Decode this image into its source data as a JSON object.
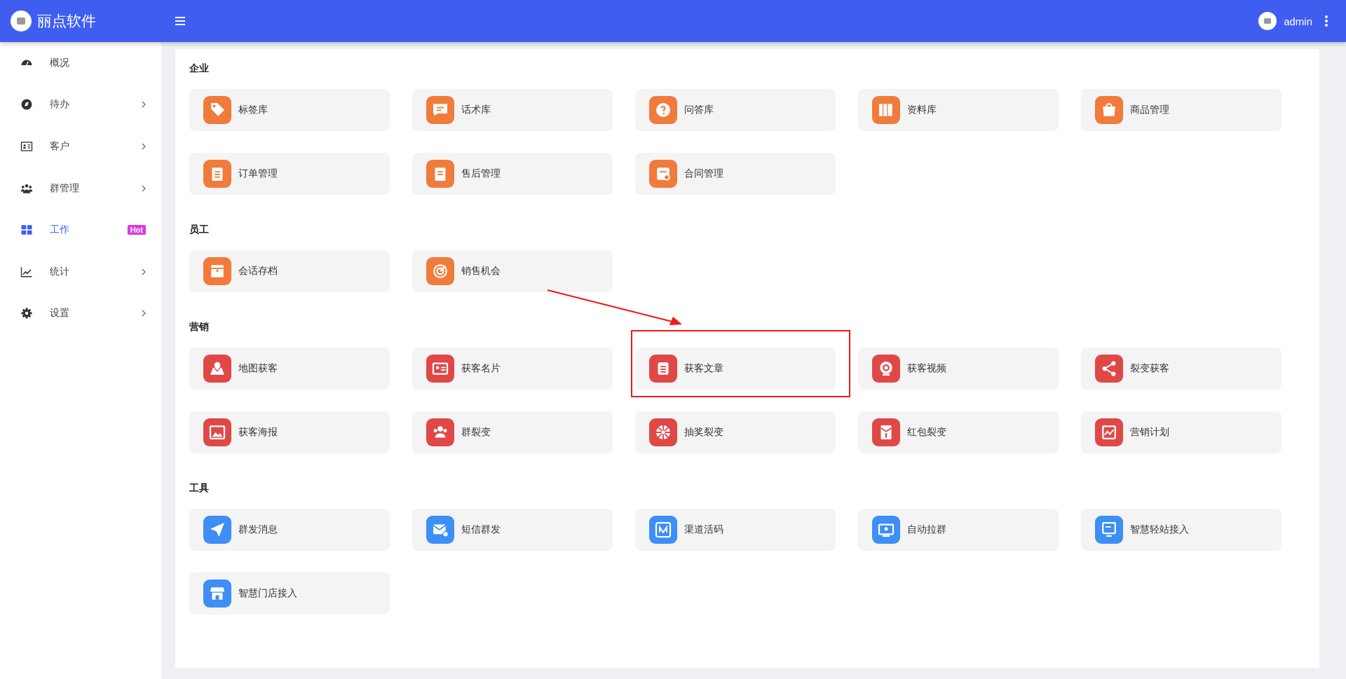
{
  "app": {
    "name": "丽点软件"
  },
  "header": {
    "user": "admin"
  },
  "sidebar": {
    "items": [
      {
        "label": "概况",
        "selected": false,
        "expandable": false
      },
      {
        "label": "待办",
        "selected": false,
        "expandable": true
      },
      {
        "label": "客户",
        "selected": false,
        "expandable": true
      },
      {
        "label": "群管理",
        "selected": false,
        "expandable": true
      },
      {
        "label": "工作",
        "selected": true,
        "expandable": false,
        "badge": "Hot"
      },
      {
        "label": "统计",
        "selected": false,
        "expandable": true
      },
      {
        "label": "设置",
        "selected": false,
        "expandable": true
      }
    ]
  },
  "sections": [
    {
      "title": "企业",
      "color": "#f07b3b",
      "tiles": [
        {
          "label": "标签库",
          "highlighted": false
        },
        {
          "label": "话术库",
          "highlighted": false
        },
        {
          "label": "问答库",
          "highlighted": false
        },
        {
          "label": "资料库",
          "highlighted": false
        },
        {
          "label": "商品管理",
          "highlighted": false
        },
        {
          "label": "订单管理",
          "highlighted": false
        },
        {
          "label": "售后管理",
          "highlighted": false
        },
        {
          "label": "合同管理",
          "highlighted": false
        }
      ]
    },
    {
      "title": "员工",
      "color": "#f07b3b",
      "tiles": [
        {
          "label": "会话存档",
          "highlighted": false
        },
        {
          "label": "销售机会",
          "highlighted": false
        }
      ]
    },
    {
      "title": "营销",
      "color": "#e04848",
      "tiles": [
        {
          "label": "地图获客",
          "highlighted": false
        },
        {
          "label": "获客名片",
          "highlighted": false
        },
        {
          "label": "获客文章",
          "highlighted": true
        },
        {
          "label": "获客视频",
          "highlighted": false
        },
        {
          "label": "裂变获客",
          "highlighted": false
        },
        {
          "label": "获客海报",
          "highlighted": false
        },
        {
          "label": "群裂变",
          "highlighted": false
        },
        {
          "label": "抽奖裂变",
          "highlighted": false
        },
        {
          "label": "红包裂变",
          "highlighted": false
        },
        {
          "label": "营销计划",
          "highlighted": false
        }
      ]
    },
    {
      "title": "工具",
      "color": "#3d8ef5",
      "tiles": [
        {
          "label": "群发消息",
          "highlighted": false
        },
        {
          "label": "短信群发",
          "highlighted": false
        },
        {
          "label": "渠道活码",
          "highlighted": false
        },
        {
          "label": "自动拉群",
          "highlighted": false
        },
        {
          "label": "智慧轻站接入",
          "highlighted": false
        },
        {
          "label": "智慧门店接入",
          "highlighted": false
        }
      ]
    }
  ]
}
